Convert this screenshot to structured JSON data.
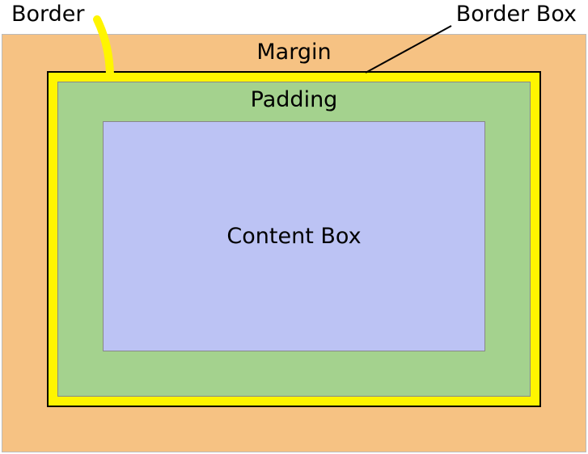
{
  "labels": {
    "border": "Border",
    "border_box": "Border Box",
    "margin": "Margin",
    "padding": "Padding",
    "content_box": "Content Box"
  }
}
